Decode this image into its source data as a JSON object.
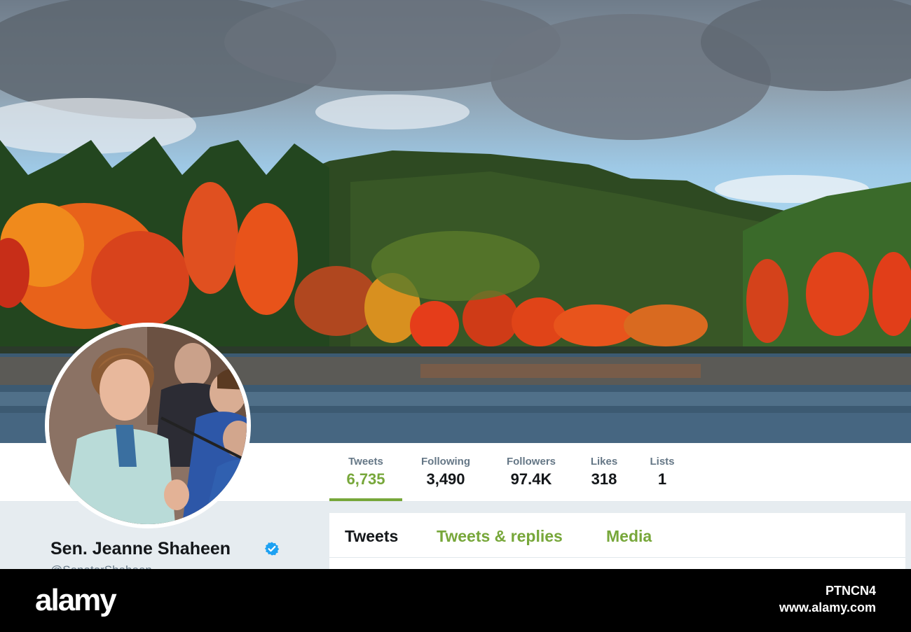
{
  "profile": {
    "name": "Sen. Jeanne Shaheen",
    "handle_partial": "@SenatorShaheen",
    "verified": true
  },
  "stats": [
    {
      "label": "Tweets",
      "value": "6,735",
      "active": true
    },
    {
      "label": "Following",
      "value": "3,490",
      "active": false
    },
    {
      "label": "Followers",
      "value": "97.4K",
      "active": false
    },
    {
      "label": "Likes",
      "value": "318",
      "active": false
    },
    {
      "label": "Lists",
      "value": "1",
      "active": false
    }
  ],
  "tabs": [
    {
      "label": "Tweets",
      "active": true
    },
    {
      "label": "Tweets & replies",
      "active": false
    },
    {
      "label": "Media",
      "active": false
    }
  ],
  "watermark": {
    "brand": "alamy",
    "image_id": "PTNCN4",
    "url": "www.alamy.com"
  },
  "colors": {
    "accent": "#77a73a",
    "text_primary": "#14171a",
    "text_secondary": "#657786",
    "verified": "#1da1f2",
    "background": "#e6ecf0"
  },
  "icons": {
    "verified": "verified-badge-icon"
  }
}
